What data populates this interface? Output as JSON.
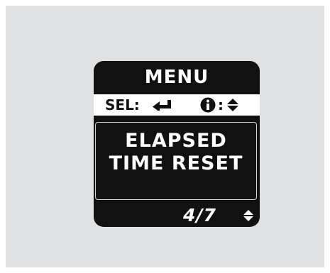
{
  "menu": {
    "title": "MENU",
    "select_hint": {
      "label": "SEL:",
      "select_icon": "enter-return-icon",
      "info_icon": "info-icon",
      "separator": ":",
      "scroll_icon": "up-down-arrow-icon"
    },
    "item": {
      "line1": "ELAPSED",
      "line2": "TIME RESET"
    },
    "page": {
      "counter": "4/7",
      "scroll_icon": "up-down-arrow-icon"
    }
  }
}
